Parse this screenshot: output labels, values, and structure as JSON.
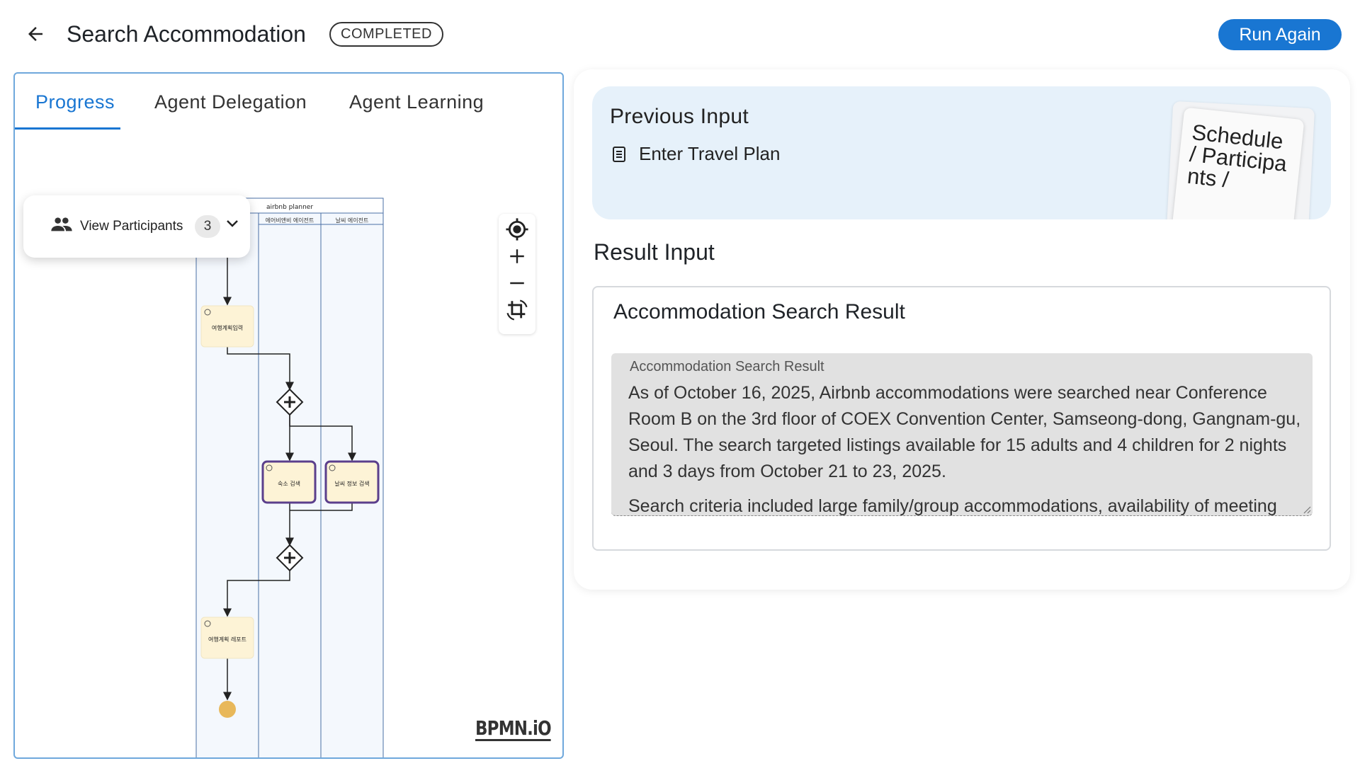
{
  "header": {
    "title": "Search Accommodation",
    "status": "COMPLETED",
    "run_again_label": "Run Again"
  },
  "tabs": [
    {
      "label": "Progress",
      "active": true
    },
    {
      "label": "Agent Delegation",
      "active": false
    },
    {
      "label": "Agent Learning",
      "active": false
    }
  ],
  "participants": {
    "label": "View Participants",
    "count": "3"
  },
  "diagram": {
    "pool_name": "airbnb planner",
    "lanes": [
      "에어비앤비 에이전트",
      "날씨 에이전트"
    ],
    "tasks": {
      "travel_plan_input": "여행계획입력",
      "accommodation_search": "숙소 검색",
      "weather_search": "날씨 정보 검색",
      "travel_report": "여행계획 레포트"
    },
    "logo": "BPMN.iO"
  },
  "previous_input": {
    "title": "Previous Input",
    "item": "Enter Travel Plan",
    "sticker_text": "Schedule / Participants /"
  },
  "result_input": {
    "title": "Result Input",
    "card_title": "Accommodation Search Result",
    "field_label": "Accommodation Search Result",
    "paragraph1": "As of October 16, 2025, Airbnb accommodations were searched near Conference Room B on the 3rd floor of COEX Convention Center, Samseong-dong, Gangnam-gu, Seoul. The search targeted listings available for 15 adults and 4 children for 2 nights and 3 days from October 21 to 23, 2025.",
    "paragraph2": "Search criteria included large family/group accommodations, availability of meeting and"
  },
  "colors": {
    "accent": "#1976d2",
    "panel_border": "#6fa8dc",
    "prev_input_bg": "#e6f1fa",
    "task_fill": "#fdf3d6",
    "task_active_border": "#5b3f8c",
    "end_event": "#e8b85a"
  }
}
